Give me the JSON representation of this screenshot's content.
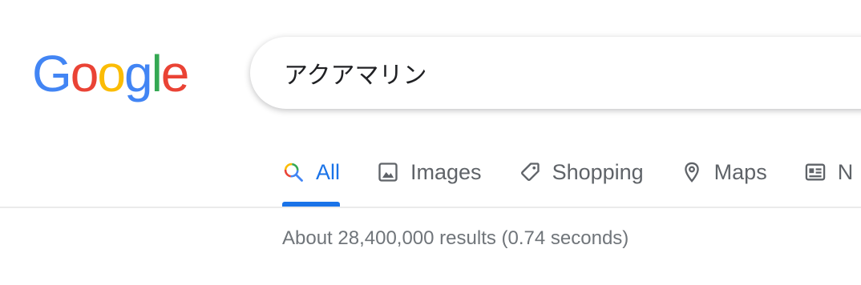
{
  "logo": {
    "letters": [
      "G",
      "o",
      "o",
      "g",
      "l",
      "e"
    ],
    "colors": [
      "#4285f4",
      "#ea4335",
      "#fbbc05",
      "#4285f4",
      "#34a853",
      "#ea4335"
    ]
  },
  "search": {
    "value": "アクアマリン"
  },
  "tabs": [
    {
      "label": "All",
      "icon": "search-icon",
      "active": true
    },
    {
      "label": "Images",
      "icon": "image-icon",
      "active": false
    },
    {
      "label": "Shopping",
      "icon": "tag-icon",
      "active": false
    },
    {
      "label": "Maps",
      "icon": "map-pin-icon",
      "active": false
    },
    {
      "label": "N",
      "icon": "news-icon",
      "active": false
    }
  ],
  "result_stats": "About 28,400,000 results (0.74 seconds)",
  "colors": {
    "accent": "#1a73e8",
    "tab_text": "#5f6368",
    "stats_text": "#70757a"
  }
}
